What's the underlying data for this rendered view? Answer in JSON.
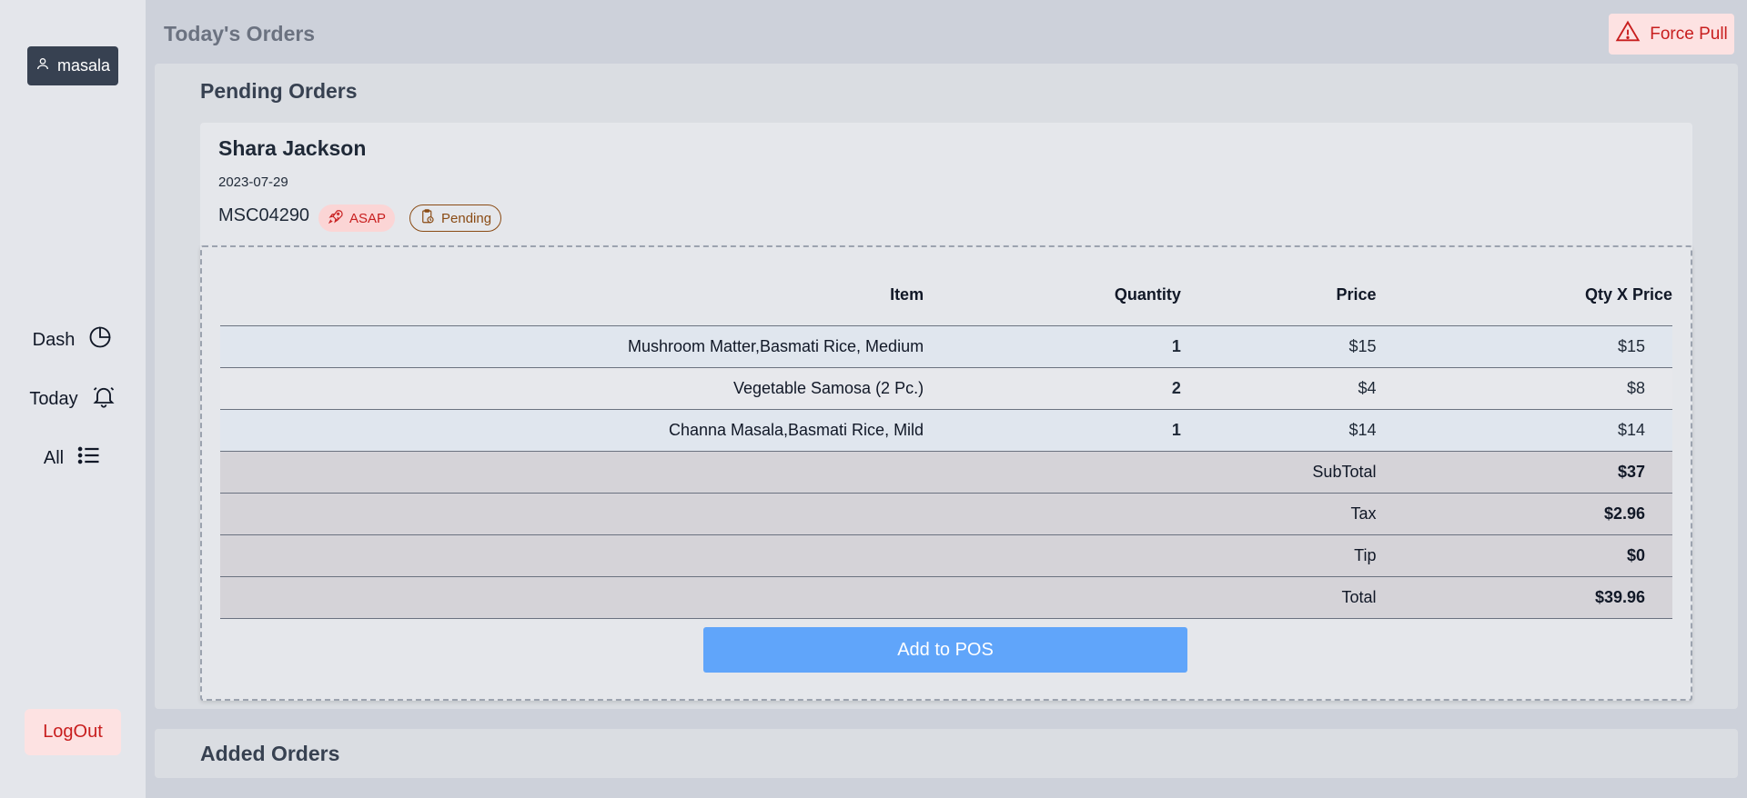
{
  "sidebar": {
    "user_label": "masala",
    "nav": [
      {
        "label": "Dash",
        "icon": "pie-chart-icon"
      },
      {
        "label": "Today",
        "icon": "bell-icon"
      },
      {
        "label": "All",
        "icon": "list-icon"
      }
    ],
    "logout_label": "LogOut"
  },
  "header": {
    "title": "Today's Orders",
    "force_pull_label": "Force Pull",
    "force_pull_icon": "warning-icon"
  },
  "pending": {
    "title": "Pending Orders",
    "order": {
      "customer": "Shara Jackson",
      "date": "2023-07-29",
      "id": "MSC04290",
      "badges": {
        "asap": "ASAP",
        "status": "Pending"
      },
      "columns": [
        "Item",
        "Quantity",
        "Price",
        "Qty X Price"
      ],
      "items": [
        {
          "name": "Mushroom Matter,Basmati Rice, Medium",
          "qty": "1",
          "price": "$15",
          "total": "$15"
        },
        {
          "name": "Vegetable Samosa (2 Pc.)",
          "qty": "2",
          "price": "$4",
          "total": "$8"
        },
        {
          "name": "Channa Masala,Basmati Rice, Mild",
          "qty": "1",
          "price": "$14",
          "total": "$14"
        }
      ],
      "summary": [
        {
          "label": "SubTotal",
          "value": "$37"
        },
        {
          "label": "Tax",
          "value": "$2.96"
        },
        {
          "label": "Tip",
          "value": "$0"
        },
        {
          "label": "Total",
          "value": "$39.96"
        }
      ],
      "add_button_label": "Add to POS"
    }
  },
  "added": {
    "title": "Added Orders"
  },
  "colors": {
    "accent_blue": "#60a5fa",
    "danger_red": "#c81e1e",
    "danger_bg": "#fde2e2",
    "dark_button": "#374151"
  }
}
